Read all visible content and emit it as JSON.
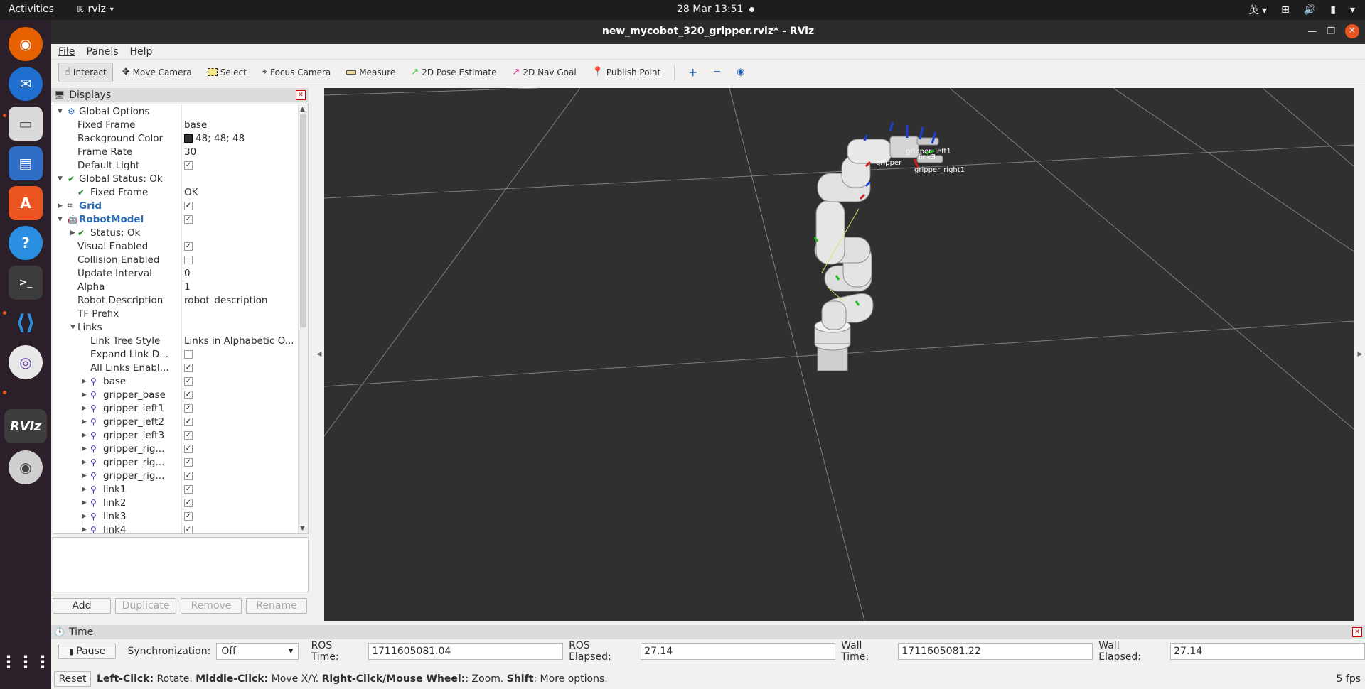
{
  "topbar": {
    "activities": "Activities",
    "app_name": "rviz",
    "clock": "28 Mar  13:51",
    "input_method": "英"
  },
  "window": {
    "title": "new_mycobot_320_gripper.rviz* - RViz"
  },
  "menu": [
    "File",
    "Panels",
    "Help"
  ],
  "toolbar": {
    "interact": "Interact",
    "move_camera": "Move Camera",
    "select": "Select",
    "focus_camera": "Focus Camera",
    "measure": "Measure",
    "pose_estimate": "2D Pose Estimate",
    "nav_goal": "2D Nav Goal",
    "publish_point": "Publish Point"
  },
  "displays": {
    "title": "Displays",
    "rows": [
      {
        "label": "Global Options",
        "value": ""
      },
      {
        "label": "Fixed Frame",
        "value": "base"
      },
      {
        "label": "Background Color",
        "value": "48; 48; 48"
      },
      {
        "label": "Frame Rate",
        "value": "30"
      },
      {
        "label": "Default Light",
        "value": ""
      },
      {
        "label": "Global Status: Ok",
        "value": ""
      },
      {
        "label": "Fixed Frame",
        "value": "OK"
      },
      {
        "label": "Grid",
        "value": ""
      },
      {
        "label": "RobotModel",
        "value": ""
      },
      {
        "label": "Status: Ok",
        "value": ""
      },
      {
        "label": "Visual Enabled",
        "value": ""
      },
      {
        "label": "Collision Enabled",
        "value": ""
      },
      {
        "label": "Update Interval",
        "value": "0"
      },
      {
        "label": "Alpha",
        "value": "1"
      },
      {
        "label": "Robot Description",
        "value": "robot_description"
      },
      {
        "label": "TF Prefix",
        "value": ""
      },
      {
        "label": "Links",
        "value": ""
      },
      {
        "label": "Link Tree Style",
        "value": "Links in Alphabetic O..."
      },
      {
        "label": "Expand Link D...",
        "value": ""
      },
      {
        "label": "All Links Enabl...",
        "value": ""
      },
      {
        "label": "base",
        "value": ""
      },
      {
        "label": "gripper_base",
        "value": ""
      },
      {
        "label": "gripper_left1",
        "value": ""
      },
      {
        "label": "gripper_left2",
        "value": ""
      },
      {
        "label": "gripper_left3",
        "value": ""
      },
      {
        "label": "gripper_rig...",
        "value": ""
      },
      {
        "label": "gripper_rig...",
        "value": ""
      },
      {
        "label": "gripper_rig...",
        "value": ""
      },
      {
        "label": "link1",
        "value": ""
      },
      {
        "label": "link2",
        "value": ""
      },
      {
        "label": "link3",
        "value": ""
      },
      {
        "label": "link4",
        "value": ""
      }
    ],
    "buttons": {
      "add": "Add",
      "duplicate": "Duplicate",
      "remove": "Remove",
      "rename": "Rename"
    }
  },
  "view": {
    "background_color": "#303030",
    "frame_labels": [
      "gripper_left1",
      "link3",
      "gripper",
      "gripper_right1"
    ]
  },
  "time": {
    "title": "Time",
    "pause": "Pause",
    "sync_label": "Synchronization:",
    "sync_value": "Off",
    "ros_time_label": "ROS Time:",
    "ros_time": "1711605081.04",
    "ros_elapsed_label": "ROS Elapsed:",
    "ros_elapsed": "27.14",
    "wall_time_label": "Wall Time:",
    "wall_time": "1711605081.22",
    "wall_elapsed_label": "Wall Elapsed:",
    "wall_elapsed": "27.14"
  },
  "status": {
    "reset": "Reset",
    "left_click": "Left-Click:",
    "left_click_txt": " Rotate. ",
    "middle_click": "Middle-Click:",
    "middle_click_txt": " Move X/Y. ",
    "right_click": "Right-Click/Mouse Wheel:",
    "right_click_txt": ": Zoom. ",
    "shift": "Shift",
    "shift_txt": ": More options.",
    "fps": "5 fps"
  }
}
